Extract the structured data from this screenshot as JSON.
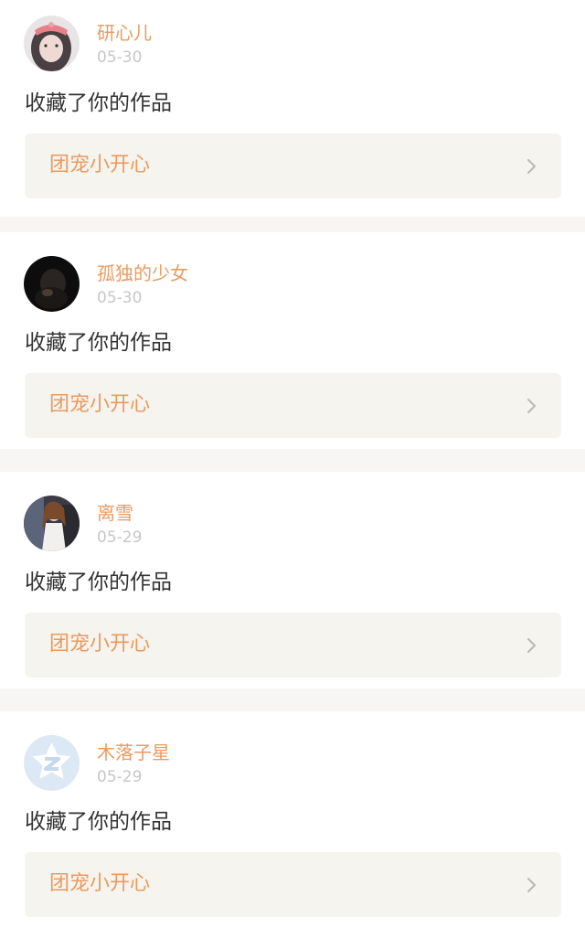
{
  "notifications": [
    {
      "username": "研心儿",
      "date": "05-30",
      "action": "收藏了你的作品",
      "work_title": "团宠小开心",
      "avatar": "girl-photo-avatar"
    },
    {
      "username": "孤独的少女",
      "date": "05-30",
      "action": "收藏了你的作品",
      "work_title": "团宠小开心",
      "avatar": "dark-photo-avatar"
    },
    {
      "username": "离雪",
      "date": "05-29",
      "action": "收藏了你的作品",
      "work_title": "团宠小开心",
      "avatar": "woman-photo-avatar"
    },
    {
      "username": "木落子星",
      "date": "05-29",
      "action": "收藏了你的作品",
      "work_title": "团宠小开心",
      "avatar": "qq-default-avatar"
    }
  ],
  "colors": {
    "accent": "#ec9a5f",
    "text": "#333333",
    "date": "#c7c7c7",
    "link_bg": "#f5f4ee",
    "separator": "#f7f6f4"
  }
}
